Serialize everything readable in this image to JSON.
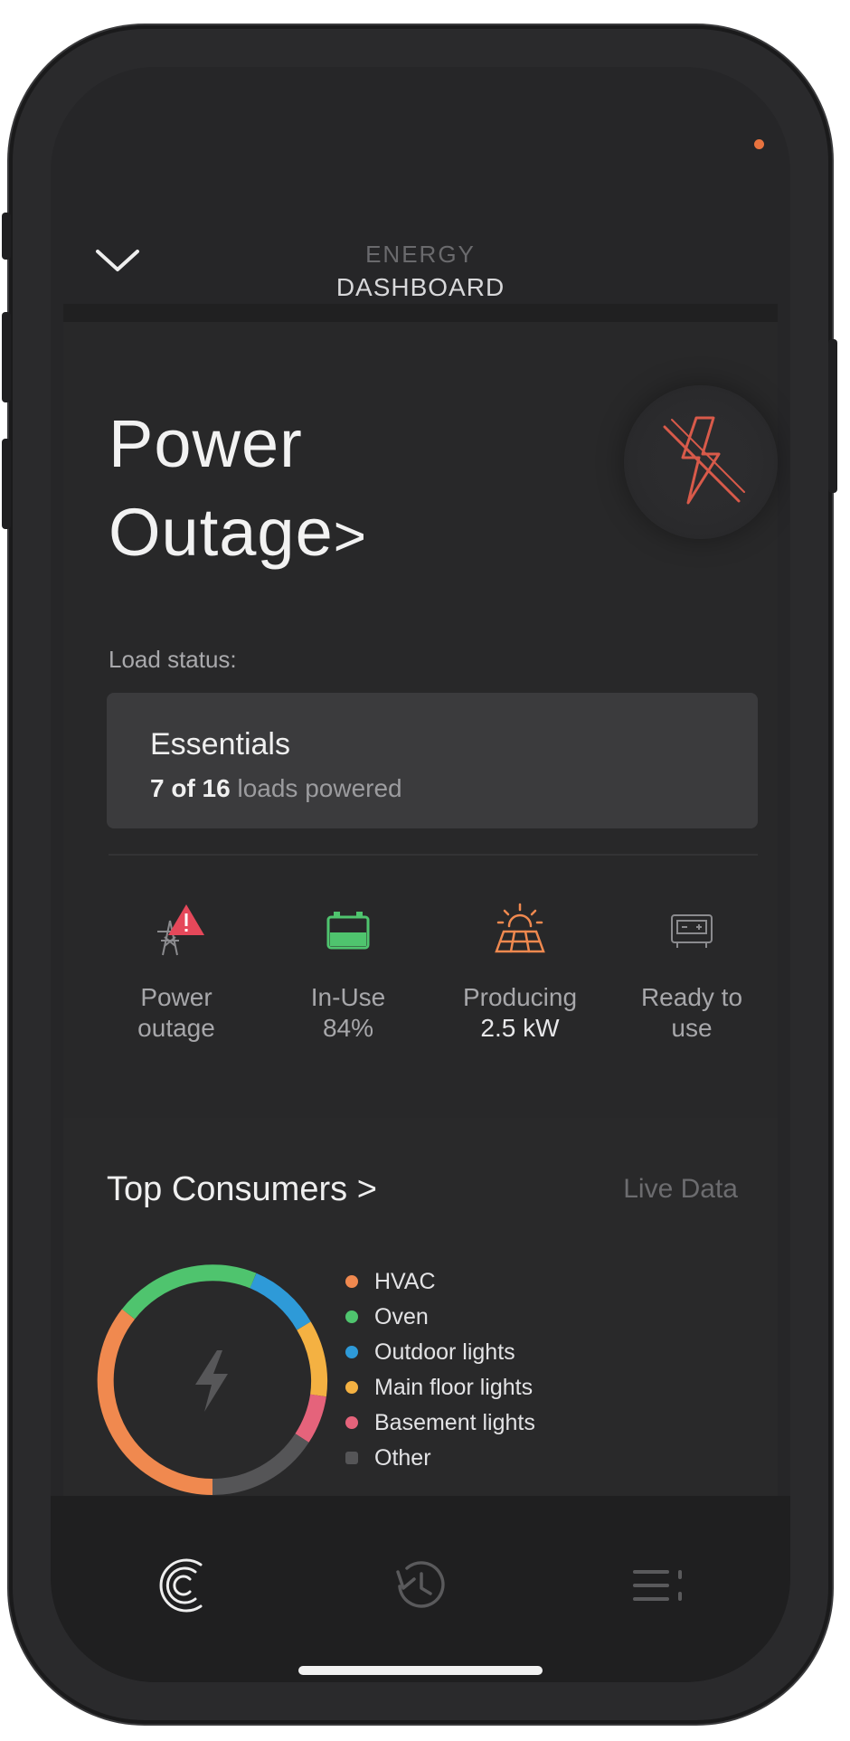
{
  "header": {
    "line1": "ENERGY",
    "line2": "DASHBOARD",
    "back_icon": "chevron-down-icon"
  },
  "outage": {
    "title_line1": "Power",
    "title_line2": "Outage",
    "title_arrow": ">",
    "status_icon": "lightning-off-icon",
    "load_status_label": "Load status:",
    "load_mode": "Essentials",
    "loads_powered": "7 of 16",
    "loads_suffix": "loads powered"
  },
  "stats": [
    {
      "icon": "grid-outage-warning-icon",
      "line1": "Power",
      "line2": "outage"
    },
    {
      "icon": "battery-icon",
      "line1": "In-Use",
      "line2": "84%"
    },
    {
      "icon": "solar-panel-icon",
      "line1": "Producing",
      "line2": "2.5 kW"
    },
    {
      "icon": "generator-icon",
      "line1": "Ready to",
      "line2": "use"
    }
  ],
  "consumers": {
    "title": "Top Consumers",
    "title_arrow": ">",
    "live_label": "Live Data",
    "center_icon": "lightning-icon",
    "legend": [
      {
        "label": "HVAC",
        "color": "#f0894f"
      },
      {
        "label": "Oven",
        "color": "#4fc46e"
      },
      {
        "label": "Outdoor lights",
        "color": "#2e9ad8"
      },
      {
        "label": "Main floor lights",
        "color": "#f4b142"
      },
      {
        "label": "Basement lights",
        "color": "#e5637b"
      },
      {
        "label": "Other",
        "color": "#555557"
      }
    ]
  },
  "nav": [
    {
      "icon": "home-logo-icon"
    },
    {
      "icon": "history-icon"
    },
    {
      "icon": "menu-icon"
    }
  ],
  "colors": {
    "accent_orange": "#e8733f",
    "warning_red": "#e5485a",
    "battery_green": "#4fc46e",
    "solar_orange": "#f0894f"
  }
}
